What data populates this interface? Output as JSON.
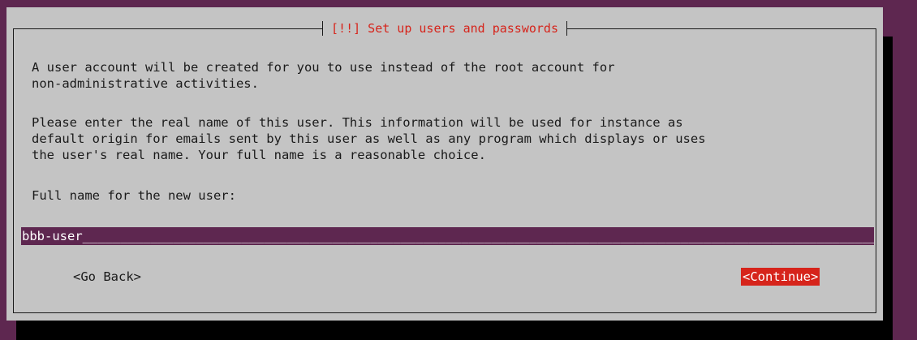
{
  "colors": {
    "background": "#5e2750",
    "dialog": "#c4c4c4",
    "accent": "#d6241b",
    "text": "#1a1a1a",
    "input_bg": "#5e2750"
  },
  "dialog": {
    "title": "[!!] Set up users and passwords",
    "paragraph1": "A user account will be created for you to use instead of the root account for\nnon-administrative activities.",
    "paragraph2": "Please enter the real name of this user. This information will be used for instance as\ndefault origin for emails sent by this user as well as any program which displays or uses\nthe user's real name. Your full name is a reasonable choice.",
    "field_label": "Full name for the new user:",
    "input_value": "bbb-user",
    "buttons": {
      "back": "<Go Back>",
      "continue": "<Continue>"
    }
  }
}
